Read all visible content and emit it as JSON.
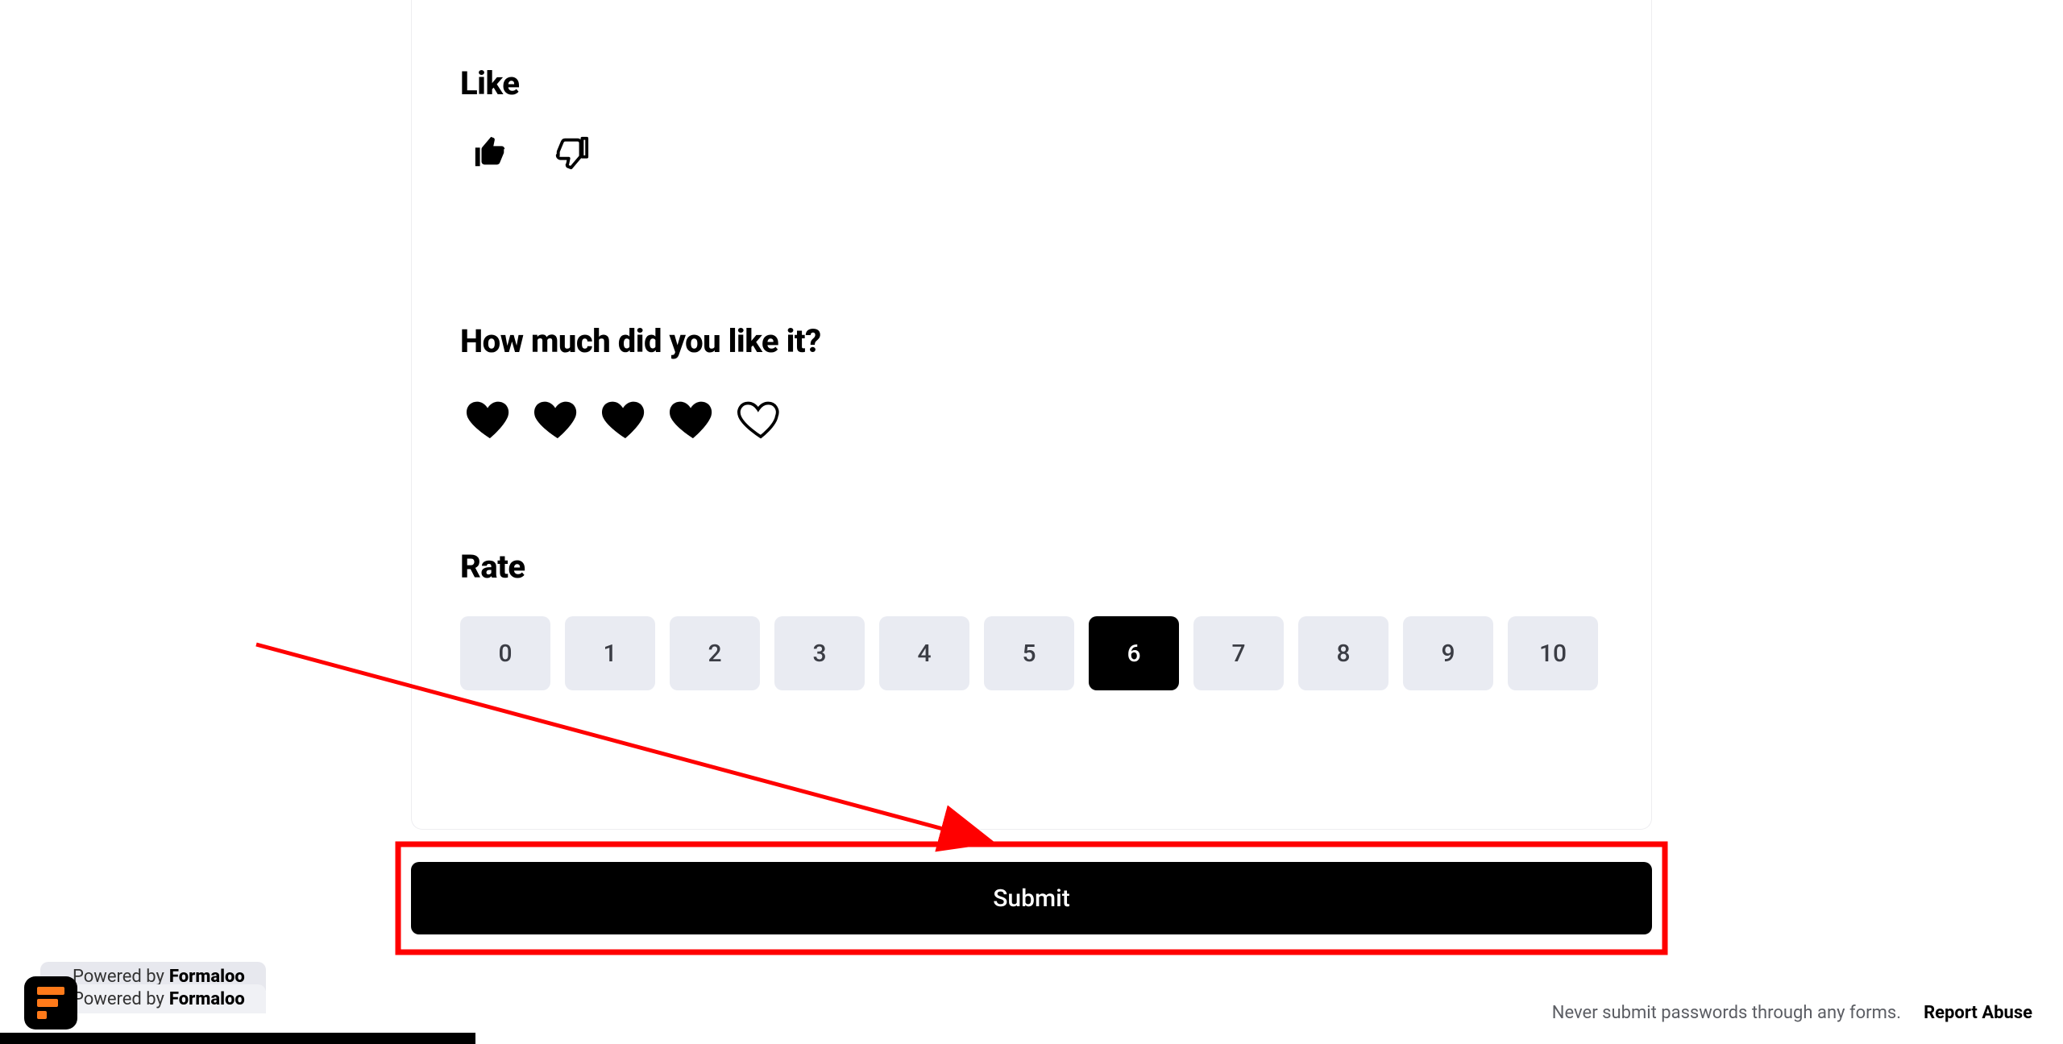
{
  "questions": {
    "like": {
      "title": "Like",
      "thumbs_up_selected": true,
      "thumbs_down_selected": false
    },
    "hearts": {
      "title": "How much did you like it?",
      "max": 5,
      "value": 4
    },
    "rate": {
      "title": "Rate",
      "options": [
        "0",
        "1",
        "2",
        "3",
        "4",
        "5",
        "6",
        "7",
        "8",
        "9",
        "10"
      ],
      "selected": "6"
    }
  },
  "submit_label": "Submit",
  "footer": {
    "warning": "Never submit passwords through any forms.",
    "report": "Report Abuse",
    "powered_prefix": "Powered by",
    "powered_brand": "Formaloo"
  },
  "annotation": {
    "highlight_box_color": "#ff0000",
    "arrow_color": "#ff0000"
  }
}
